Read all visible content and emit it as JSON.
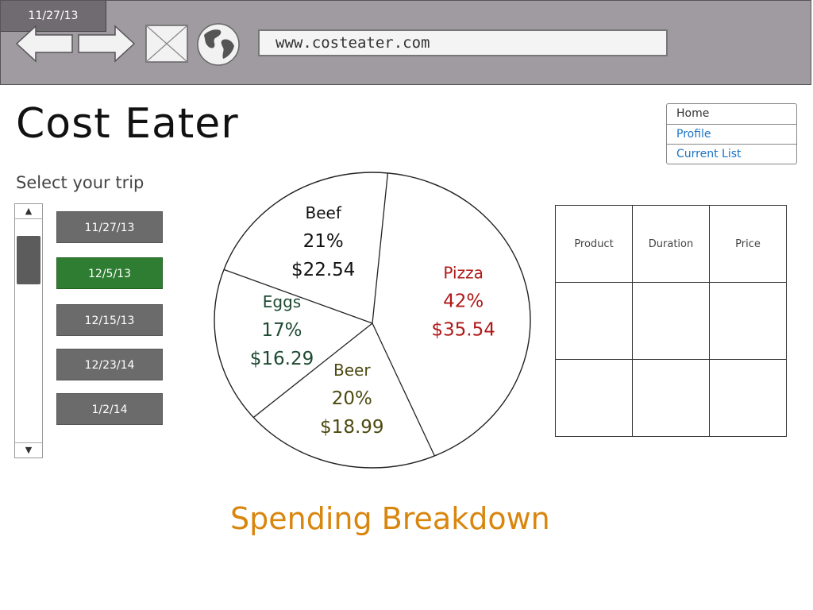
{
  "browser": {
    "tab_date": "11/27/13",
    "url": "www.costeater.com",
    "icons": [
      "back-arrow-icon",
      "forward-arrow-icon",
      "image-placeholder-icon",
      "globe-icon"
    ]
  },
  "app": {
    "title": "Cost Eater"
  },
  "nav": {
    "items": [
      {
        "label": "Home",
        "active": true
      },
      {
        "label": "Profile",
        "active": false
      },
      {
        "label": "Current List",
        "active": false
      }
    ]
  },
  "trips": {
    "label": "Select your trip",
    "items": [
      {
        "label": "11/27/13",
        "selected": false
      },
      {
        "label": "12/5/13",
        "selected": true
      },
      {
        "label": "12/15/13",
        "selected": false
      },
      {
        "label": "12/23/14",
        "selected": false
      },
      {
        "label": "1/2/14",
        "selected": false
      }
    ]
  },
  "chart_data": {
    "type": "pie",
    "title": "Spending Breakdown",
    "slices": [
      {
        "label": "Beef",
        "percent": "21%",
        "value": 21,
        "amount": "$22.54",
        "color": "#111111"
      },
      {
        "label": "Pizza",
        "percent": "42%",
        "value": 42,
        "amount": "$35.54",
        "color": "#b01818"
      },
      {
        "label": "Beer",
        "percent": "20%",
        "value": 20,
        "amount": "$18.99",
        "color": "#4d4a10"
      },
      {
        "label": "Eggs",
        "percent": "17%",
        "value": 17,
        "amount": "$16.29",
        "color": "#1e4a32"
      }
    ]
  },
  "table": {
    "headers": [
      "Product",
      "Duration",
      "Price"
    ],
    "rows": [
      [
        "",
        "",
        ""
      ],
      [
        "",
        "",
        ""
      ]
    ]
  },
  "colors": {
    "topbar": "#a09aa1",
    "trip_button": "#6b6b6b",
    "trip_button_selected": "#2f7d32",
    "chart_title": "#d9860e",
    "nav_link": "#1a73c4"
  }
}
